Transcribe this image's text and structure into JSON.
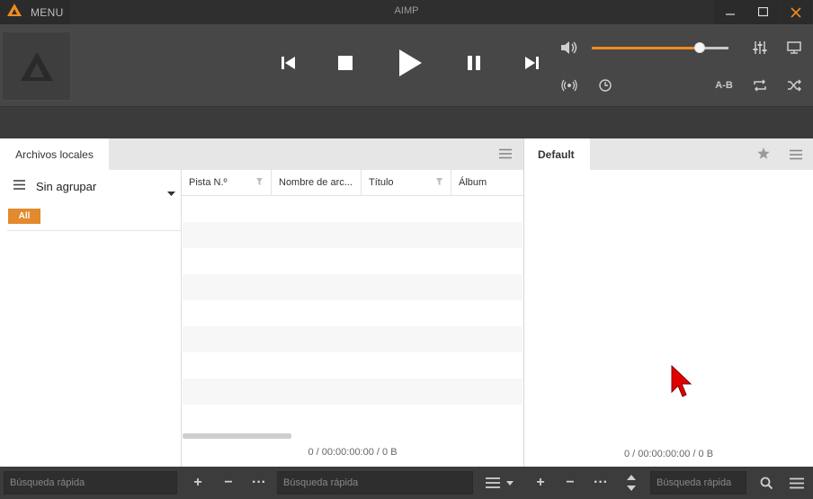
{
  "window": {
    "title": "AIMP",
    "menu_label": "MENU"
  },
  "player": {
    "volume_fraction": 0.79,
    "ab_label": "A-B",
    "accent_color": "#f08c1e"
  },
  "left_panel": {
    "tab_label": "Archivos locales",
    "group_label": "Sin agrupar",
    "all_badge": "All",
    "columns": [
      "Pista N.º",
      "Nombre de arc...",
      "Título",
      "Álbum"
    ],
    "status": "0 / 00:00:00:00 / 0 B"
  },
  "right_panel": {
    "tab_label": "Default",
    "status": "0 / 00:00:00:00 / 0 B"
  },
  "bottom": {
    "search_placeholder_1": "Búsqueda rápida",
    "search_placeholder_2": "Búsqueda rápida",
    "search_placeholder_3": "Búsqueda rápida"
  },
  "icons": {
    "logo": "aimp-logo-icon",
    "minimize": "minimize-icon",
    "maximize": "maximize-icon",
    "close": "close-icon"
  }
}
